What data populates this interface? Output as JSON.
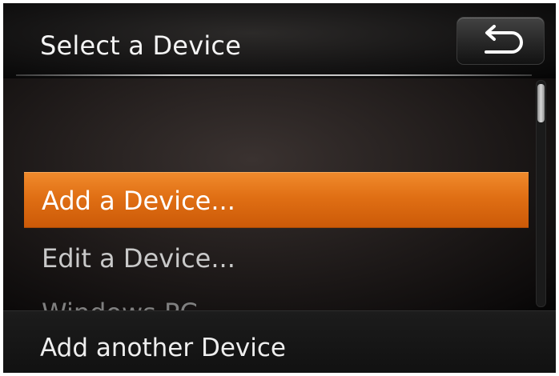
{
  "header": {
    "title": "Select a Device",
    "back_icon": "return-arrow-icon"
  },
  "device_list": {
    "items": [
      {
        "label": ""
      },
      {
        "label": "Add a Device...",
        "selected": true
      },
      {
        "label": "Edit a Device..."
      },
      {
        "label": "Windows PC"
      }
    ]
  },
  "scrollbar": {
    "position_fraction": 0.0
  },
  "footer": {
    "text": "Add another Device"
  },
  "colors": {
    "selection": "#e0701a",
    "background": "#000000",
    "text": "#f4f4f4"
  }
}
